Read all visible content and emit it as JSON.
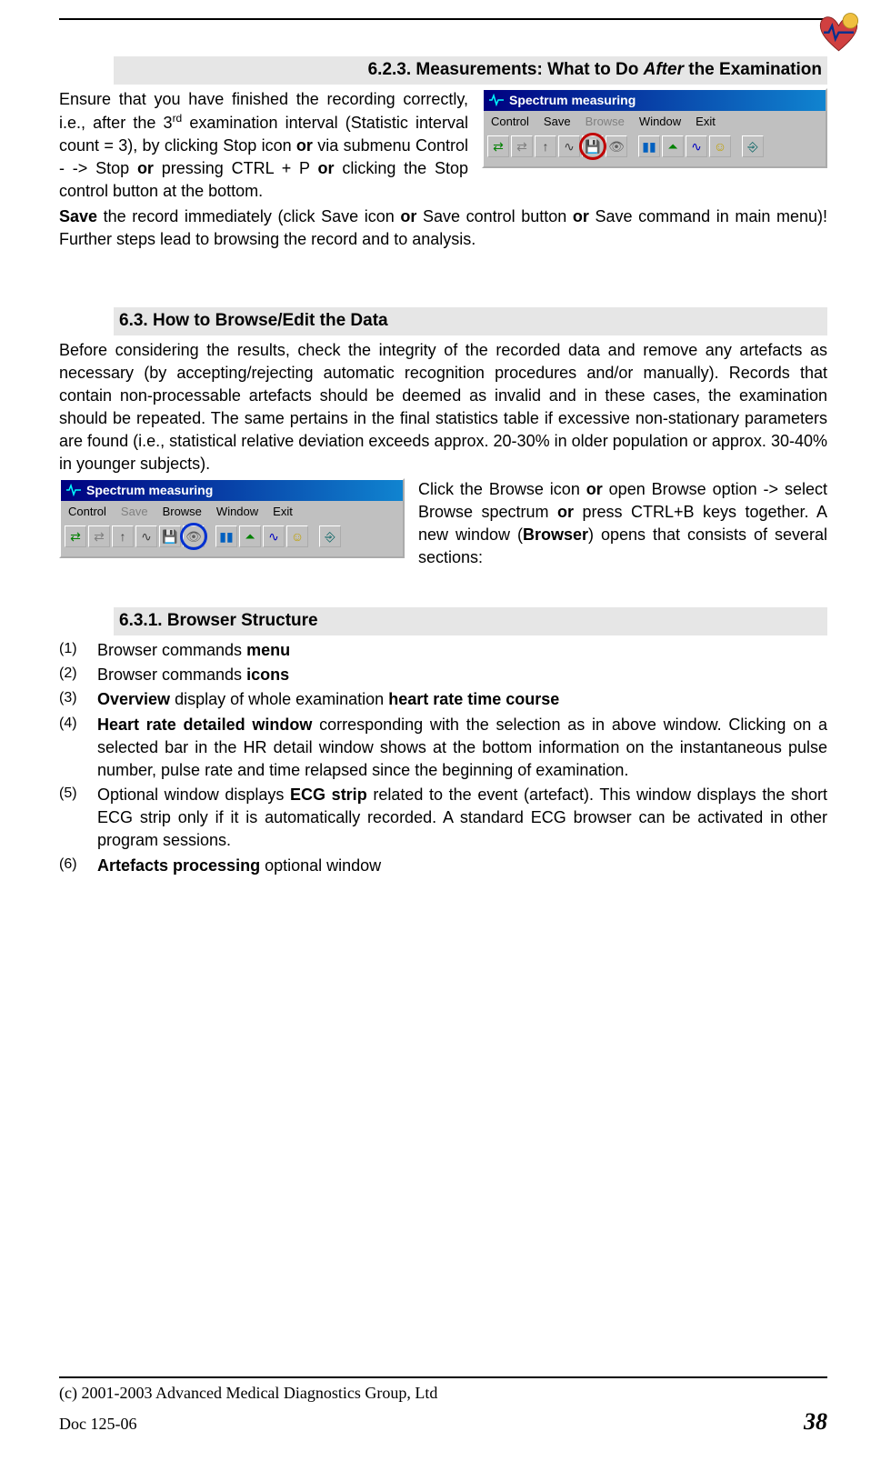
{
  "headings": {
    "h623": "6.2.3. Measurements: What to Do ",
    "h623_after": "After",
    "h623_tail": " the Examination",
    "h63": "6.3. How to Browse/Edit the Data",
    "h631": "6.3.1. Browser Structure"
  },
  "toolbar1": {
    "title": "Spectrum measuring",
    "menu": [
      "Control",
      "Save",
      "Browse",
      "Window",
      "Exit"
    ],
    "highlight_icon": "save-disk-icon"
  },
  "toolbar2": {
    "title": "Spectrum measuring",
    "menu": [
      "Control",
      "Save",
      "Browse",
      "Window",
      "Exit"
    ],
    "highlight_icon": "eye-icon"
  },
  "body": {
    "p623_a": "Ensure that you have finished the recording correctly, i.e., after the 3",
    "p623_a_sup": "rd",
    "p623_a2": " examination interval (Statistic interval count = 3), by clicking Stop icon ",
    "p623_or1": "or",
    "p623_a3": " via submenu Control - -> Stop ",
    "p623_or2": "or",
    "p623_a4": " pressing CTRL + P ",
    "p623_or3": "or",
    "p623_a5": " clicking the Stop control button at the bottom.",
    "p623_b_save": "Save",
    "p623_b1": " the record immediately (click Save icon ",
    "p623_b_or1": "or",
    "p623_b2": " Save control button ",
    "p623_b_or2": "or",
    "p623_b3": " Save command in main menu)! Further steps lead to browsing the record and to analysis.",
    "p63_a": "Before considering the results, check the integrity of the recorded data and remove any artefacts as necessary (by accepting/rejecting automatic recognition procedures and/or manually). Records that contain non-processable artefacts should be deemed as invalid and in these cases, the examination should be repeated. The same pertains in the final statistics table if excessive non-stationary parameters are found (i.e., statistical relative deviation exceeds approx. 20-30% in older population or approx. 30-40% in younger subjects).",
    "p63_b1": "Click the Browse icon ",
    "p63_b_or1": "or",
    "p63_b2": " open Browse option -> select Browse spectrum ",
    "p63_b_or2": "or",
    "p63_b3": " press CTRL+B keys together. A new window (",
    "p63_b_browser": "Browser",
    "p63_b4": ") opens that consists of several sections:"
  },
  "list631": {
    "i1a": "Browser commands ",
    "i1b": "menu",
    "i2a": "Browser commands ",
    "i2b": "icons",
    "i3a": "Overview",
    "i3b": " display of whole examination ",
    "i3c": "heart rate time course",
    "i4a": "Heart rate detailed window",
    "i4b": " corresponding with the selection as in above window. Clicking on a selected bar in the HR detail window shows at the bottom information on the instantaneous pulse number, pulse rate and time relapsed since the beginning of examination.",
    "i5a": "Optional window displays ",
    "i5b": "ECG strip",
    "i5c": " related to the event (artefact). This window displays the short ECG strip only if it is automatically recorded. A standard ECG browser can be activated in other program sessions.",
    "i6a": "Artefacts processing",
    "i6b": " optional window"
  },
  "footer": {
    "copyright": "(c) 2001-2003 Advanced Medical Diagnostics Group, Ltd",
    "docid": "Doc 125-06",
    "page": "38"
  }
}
